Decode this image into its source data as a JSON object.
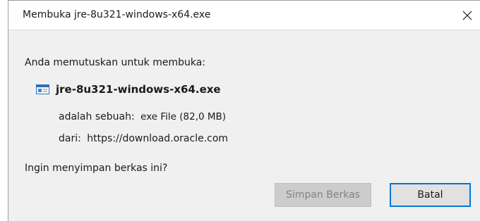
{
  "dialog": {
    "title": "Membuka jre-8u321-windows-x64.exe",
    "close_icon": "close-icon",
    "prompt": "Anda memutuskan untuk membuka:",
    "file": {
      "icon": "executable-file-icon",
      "name": "jre-8u321-windows-x64.exe"
    },
    "type_label": "adalah sebuah:",
    "type_value": "exe File (82,0 MB)",
    "from_label": "dari:",
    "from_value": "https://download.oracle.com",
    "question": "Ingin menyimpan berkas ini?",
    "buttons": {
      "save": "Simpan Berkas",
      "cancel": "Batal"
    }
  },
  "colors": {
    "accent": "#0078d7",
    "dialog_background": "#f0f0f0",
    "titlebar_background": "#ffffff",
    "disabled_button": "#cccccc",
    "disabled_text": "#838383"
  }
}
